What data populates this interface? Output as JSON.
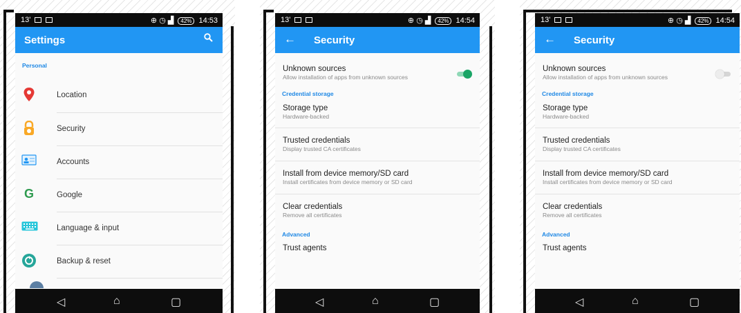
{
  "status_left": "13'",
  "screens": [
    {
      "time": "14:53",
      "battery": "42%",
      "app_title": "Settings",
      "section": "Personal",
      "items": [
        "Location",
        "Security",
        "Accounts",
        "Google",
        "Language & input",
        "Backup & reset"
      ],
      "icons": [
        "location-pin-icon",
        "lock-icon",
        "accounts-card-icon",
        "google-g-icon",
        "keyboard-icon",
        "backup-restore-icon"
      ]
    },
    {
      "time": "14:54",
      "battery": "42%",
      "app_title": "Security",
      "unknown_title": "Unknown sources",
      "unknown_sub": "Allow installation of apps from unknown sources",
      "toggle_on": true,
      "cred_header": "Credential storage",
      "rows": [
        {
          "title": "Storage type",
          "sub": "Hardware-backed"
        },
        {
          "title": "Trusted credentials",
          "sub": "Display trusted CA certificates"
        },
        {
          "title": "Install from device memory/SD card",
          "sub": "Install certificates from device memory or SD card"
        },
        {
          "title": "Clear credentials",
          "sub": "Remove all certificates"
        }
      ],
      "adv_header": "Advanced",
      "trust_agents": "Trust agents"
    },
    {
      "time": "14:54",
      "battery": "42%",
      "app_title": "Security",
      "unknown_title": "Unknown sources",
      "unknown_sub": "Allow installation of apps from unknown sources",
      "toggle_on": false,
      "cred_header": "Credential storage",
      "rows": [
        {
          "title": "Storage type",
          "sub": "Hardware-backed"
        },
        {
          "title": "Trusted credentials",
          "sub": "Display trusted CA certificates"
        },
        {
          "title": "Install from device memory/SD card",
          "sub": "Install certificates from device memory or SD card"
        },
        {
          "title": "Clear credentials",
          "sub": "Remove all certificates"
        }
      ],
      "adv_header": "Advanced",
      "trust_agents": "Trust agents"
    }
  ],
  "colors": {
    "accent": "#2196f3",
    "toggle_on": "#1aa566",
    "toggle_on_track": "#8fd8b6",
    "toggle_off": "#e6e6e6",
    "status_bar": "#0d0d0d"
  }
}
